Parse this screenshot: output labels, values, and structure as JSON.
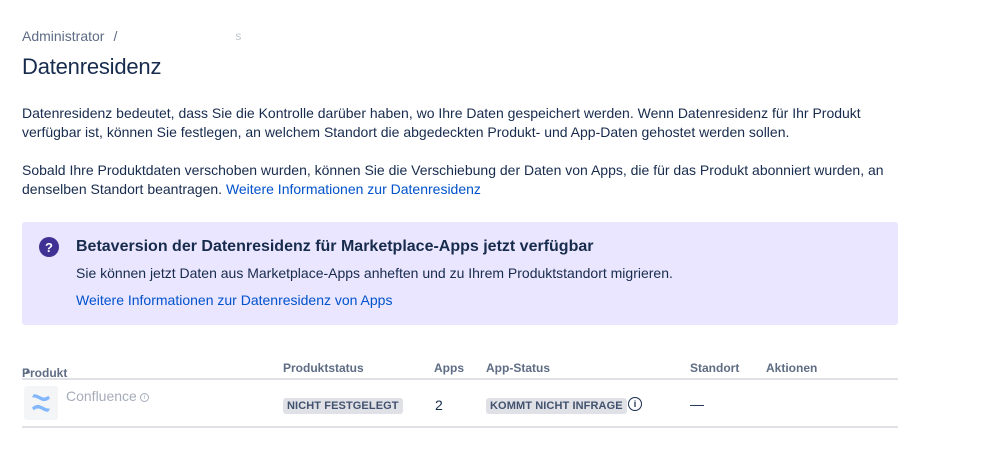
{
  "breadcrumb": {
    "root": "Administrator",
    "separator": "/",
    "redacted": "s"
  },
  "page": {
    "title": "Datenresidenz"
  },
  "intro": {
    "p1": "Datenresidenz bedeutet, dass Sie die Kontrolle darüber haben, wo Ihre Daten gespeichert werden. Wenn Datenresidenz für Ihr Produkt verfügbar ist, können Sie festlegen, an welchem Standort die abgedeckten Produkt- und App-Daten gehostet werden sollen.",
    "p2": "Sobald Ihre Produktdaten verschoben wurden, können Sie die Verschiebung der Daten von Apps, die für das Produkt abonniert wurden, an denselben Standort beantragen.",
    "p2_link": "Weitere Informationen zur Datenresidenz"
  },
  "banner": {
    "icon": "question-circle-icon",
    "title": "Betaversion der Datenresidenz für Marketplace-Apps jetzt verfügbar",
    "text": "Sie können jetzt Daten aus Marketplace-Apps anheften und zu Ihrem Produktstandort migrieren.",
    "link": "Weitere Informationen zur Datenresidenz von Apps",
    "background": "#eae6ff",
    "icon_color": "#403294"
  },
  "table": {
    "headers": {
      "product": "Produkt",
      "product_status": "Produktstatus",
      "apps": "Apps",
      "app_status": "App-Status",
      "location": "Standort",
      "actions": "Aktionen"
    },
    "rows": [
      {
        "product": "Confluence",
        "product_status": "NICHT FESTGELEGT",
        "apps": "2",
        "app_status": "KOMMT NICHT INFRAGE",
        "location": "—"
      }
    ]
  },
  "colors": {
    "link": "#0052cc",
    "text": "#172b4d",
    "subtle": "#5e6c84"
  }
}
